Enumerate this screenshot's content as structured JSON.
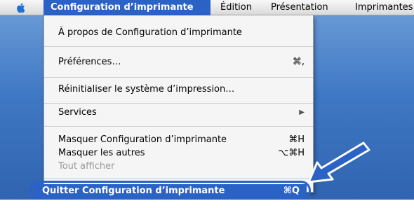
{
  "menubar": {
    "app_menu": "Configuration d’imprimante",
    "items": [
      "Édition",
      "Présentation",
      "Imprimantes"
    ]
  },
  "dropdown": {
    "items": [
      {
        "label": "À propos de Configuration d’imprimante",
        "shortcut": ""
      },
      {
        "label": "Préférences…",
        "shortcut": "⌘,"
      },
      {
        "label": "Réinitialiser le système d’impression…",
        "shortcut": ""
      },
      {
        "label": "Services",
        "shortcut": "▶"
      },
      {
        "label": "Masquer Configuration d’imprimante",
        "shortcut": "⌘H"
      },
      {
        "label": "Masquer les autres",
        "shortcut": "⌥⌘H"
      },
      {
        "label": "Tout afficher",
        "shortcut": ""
      },
      {
        "label": "Quitter Configuration d’imprimante",
        "shortcut": "⌘Q"
      }
    ]
  },
  "icons": {
    "apple": "apple-icon",
    "submenu": "submenu-arrow-icon",
    "pointer": "callout-arrow-icon"
  },
  "colors": {
    "highlight": "#2a62c6",
    "desktop": "#3f78c4"
  }
}
